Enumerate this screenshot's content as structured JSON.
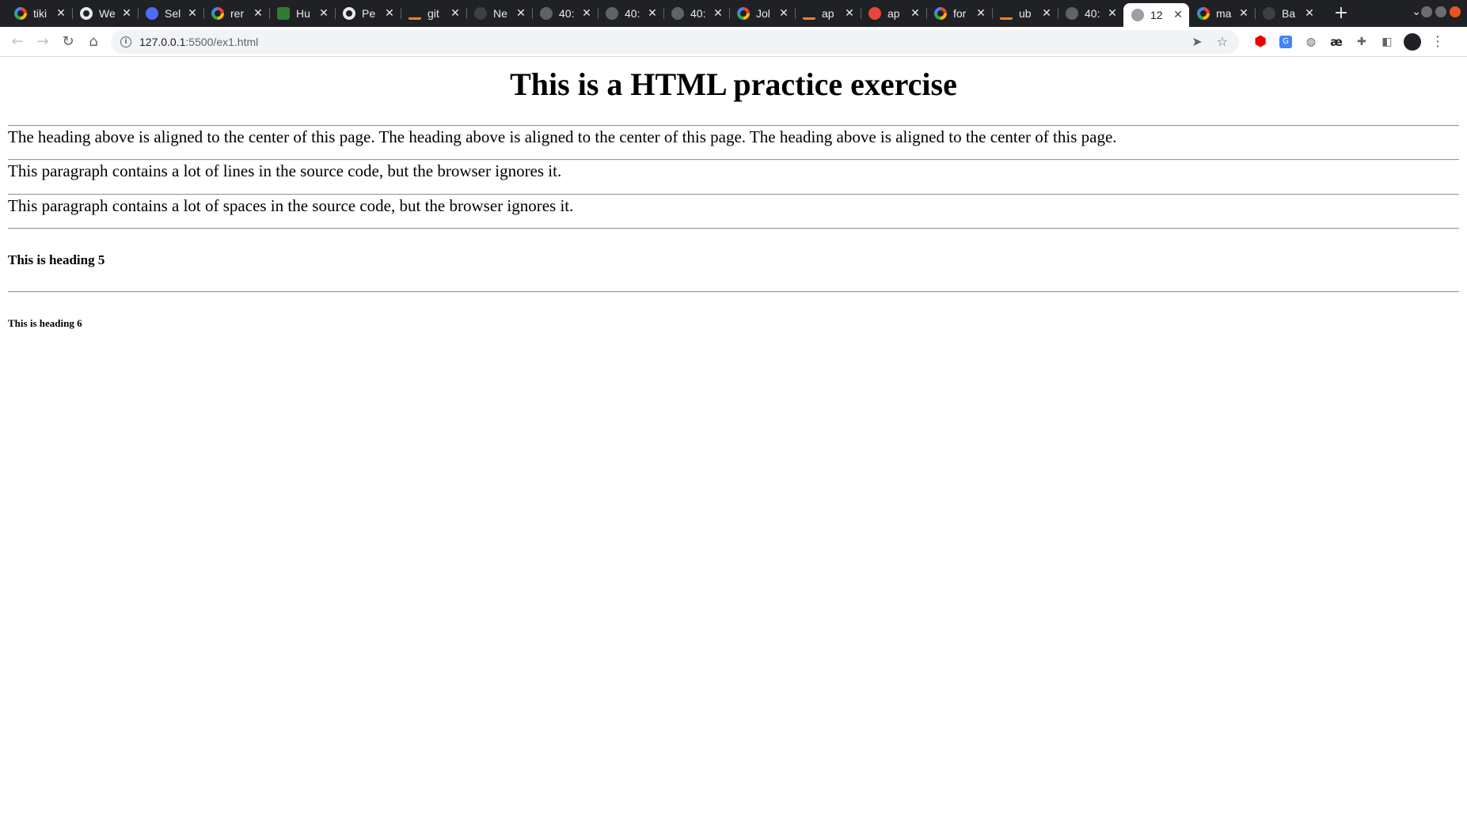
{
  "browser": {
    "tabs": [
      {
        "title": "tiki",
        "icon": "google-icon"
      },
      {
        "title": "We",
        "icon": "github-icon"
      },
      {
        "title": "Sel",
        "icon": "selenium-icon"
      },
      {
        "title": "rer",
        "icon": "google-icon"
      },
      {
        "title": "Hu",
        "icon": "lab-icon"
      },
      {
        "title": "Pe",
        "icon": "github-icon"
      },
      {
        "title": "git",
        "icon": "stackoverflow-icon"
      },
      {
        "title": "Ne",
        "icon": "dark-site-icon"
      },
      {
        "title": "40:",
        "icon": "globe-icon"
      },
      {
        "title": "40:",
        "icon": "globe-icon"
      },
      {
        "title": "40:",
        "icon": "globe-icon"
      },
      {
        "title": "Jol",
        "icon": "google-icon"
      },
      {
        "title": "ap",
        "icon": "stackoverflow-icon"
      },
      {
        "title": "ap",
        "icon": "askubuntu-icon"
      },
      {
        "title": "for",
        "icon": "google-icon"
      },
      {
        "title": "ub",
        "icon": "stackoverflow-icon"
      },
      {
        "title": "40:",
        "icon": "globe-icon"
      },
      {
        "title": "12",
        "icon": "world-icon",
        "active": true
      },
      {
        "title": "ma",
        "icon": "google-icon"
      },
      {
        "title": "Ba",
        "icon": "dark-site-icon"
      }
    ],
    "address": {
      "host": "127.0.0.1",
      "path": ":5500/ex1.html"
    }
  },
  "page": {
    "heading1": "This is a HTML practice exercise",
    "paragraph1": "The heading above is aligned to the center of this page. The heading above is aligned to the center of this page. The heading above is aligned to the center of this page.",
    "paragraph2": "This paragraph contains a lot of lines in the source code, but the browser ignores it.",
    "paragraph3": "This paragraph contains a lot of spaces in the source code, but the browser ignores it.",
    "heading5": "This is heading 5",
    "heading6": "This is heading 6"
  }
}
